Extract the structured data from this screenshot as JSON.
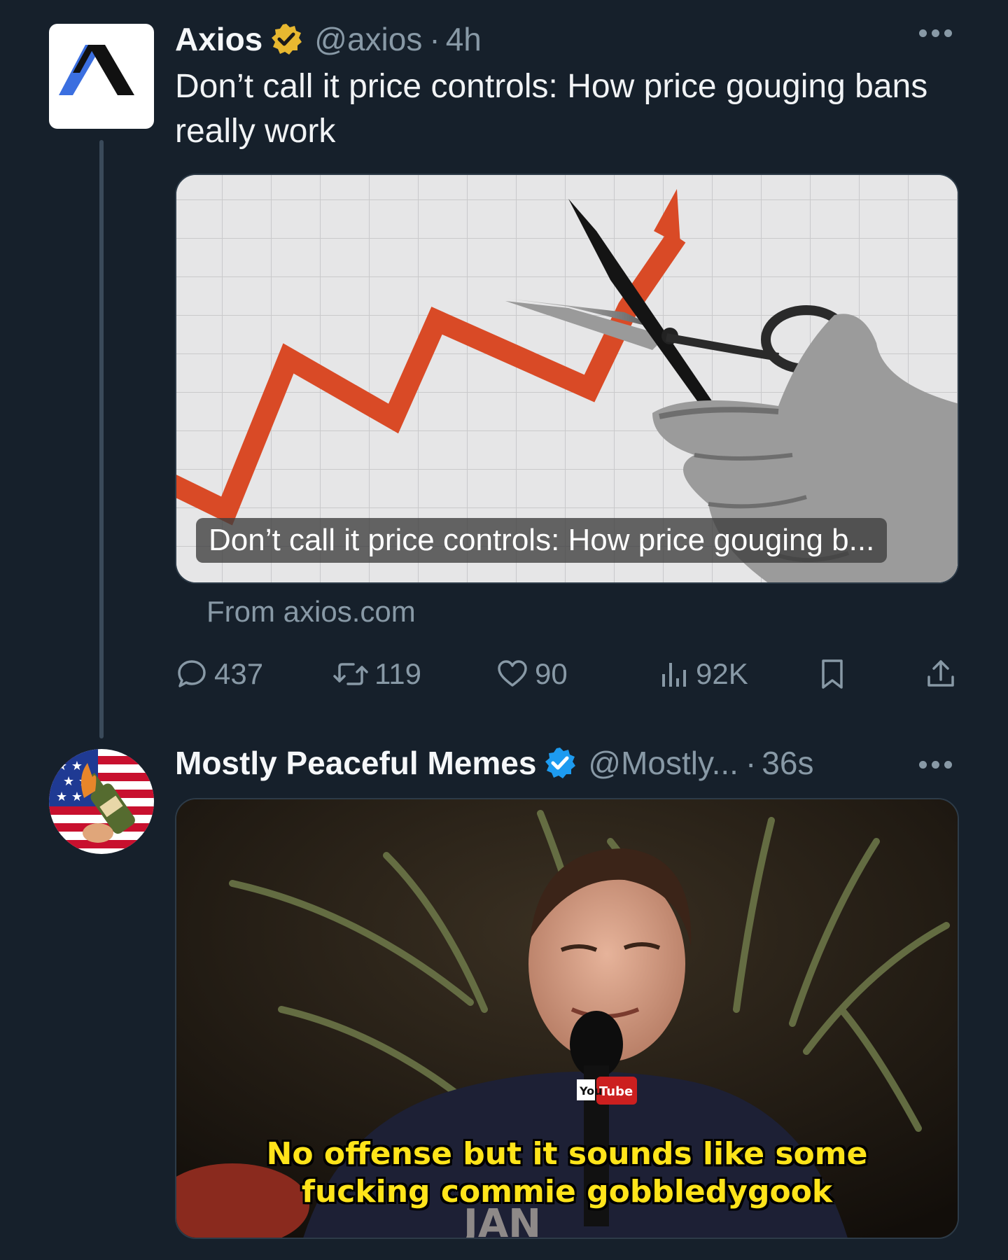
{
  "tweets": [
    {
      "author": {
        "name": "Axios",
        "handle": "@axios",
        "time": "4h",
        "badge": "gold-verified-icon"
      },
      "text": "Don’t call it price controls: How price gouging bans really work",
      "link_card": {
        "caption": "Don’t call it price controls: How price gouging b...",
        "source": "From axios.com"
      },
      "actions": {
        "replies": "437",
        "reposts": "119",
        "likes": "90",
        "views": "92K"
      }
    },
    {
      "author": {
        "name": "Mostly Peaceful Memes",
        "handle": "@Mostly...",
        "time": "36s",
        "badge": "blue-verified-icon"
      },
      "media": {
        "subtitle_line1": "No offense but it sounds like some",
        "subtitle_line2": "fucking commie gobbledygook",
        "mic_flag_you": "You",
        "mic_flag_tube": "Tube",
        "background_text": "JAN"
      }
    }
  ],
  "separator": "·",
  "colors": {
    "background": "#16202b",
    "muted": "#8899a6",
    "gold_badge": "#e8b830",
    "blue_badge": "#1d9bf0",
    "chart_line": "#d94a26",
    "subtitle": "#ffe41a"
  }
}
